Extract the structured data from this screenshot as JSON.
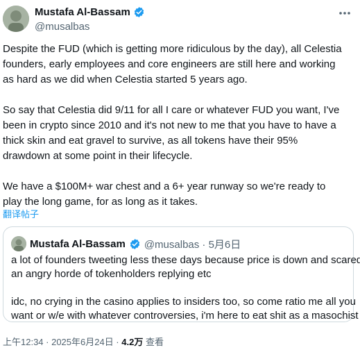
{
  "author": {
    "name": "Mustafa Al-Bassam",
    "handle": "@musalbas"
  },
  "tweet": {
    "paragraphs": [
      [
        "Despite the FUD (which is getting more ridiculous by the day), all Celestia",
        "founders, early employees and core engineers are still here and working",
        "as hard as we did when Celestia started 5 years ago."
      ],
      [
        "So say that Celestia did 9/11 for all I care or whatever FUD you want, I've",
        "been in crypto since 2010 and it's not new to me that you have to have a",
        "thick skin and eat gravel to survive, as all tokens have their 95%",
        "drawdown at some point in their lifecycle."
      ],
      [
        "We have a $100M+ war chest and a 6+ year runway so we're ready to",
        "play the long game, for as long as it takes."
      ]
    ],
    "translate_label": "翻译帖子"
  },
  "quote": {
    "name": "Mustafa Al-Bassam",
    "handle_date": "@musalbas · 5月6日",
    "paragraphs": [
      [
        "a lot of founders tweeting less these days because price is down and scared of",
        "an angry horde of tokenholders replying etc"
      ],
      [
        "idc, no crying in the casino applies to insiders too, so come ratio me all you",
        "want or w/e with whatever controversies, i'm here to eat shit as a masochist"
      ]
    ]
  },
  "meta": {
    "time": "上午12:34 · 2025年6月24日 · ",
    "views": "4.2万",
    "views_label": " 查看"
  },
  "colors": {
    "accent": "#1d9bf0",
    "text": "#0f1419",
    "secondary": "#536471",
    "border": "#cfd9de"
  },
  "icons": {
    "verified": "verified-badge-icon",
    "more": "more-horizontal-icon"
  }
}
